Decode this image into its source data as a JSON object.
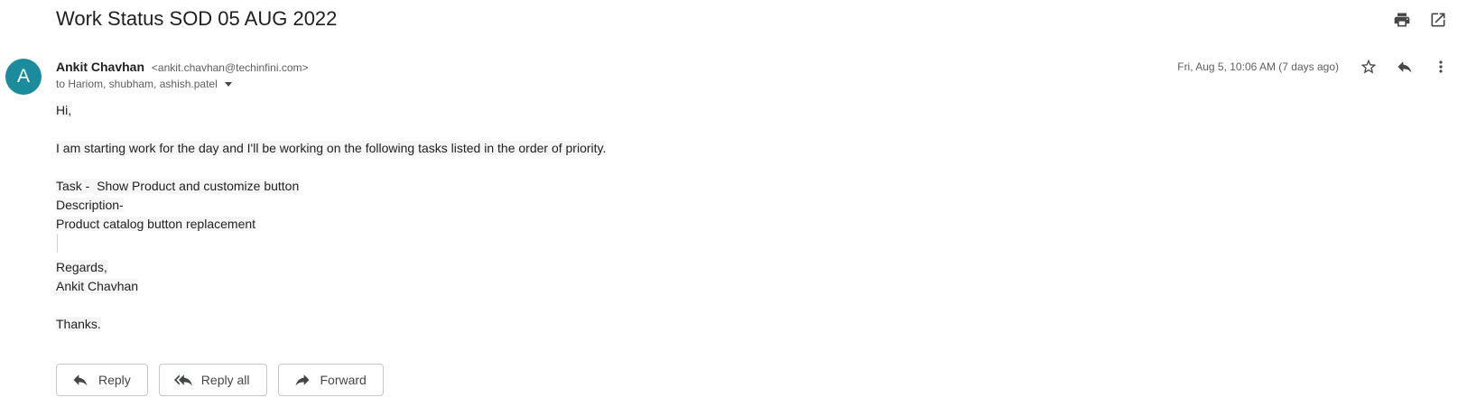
{
  "email": {
    "subject": "Work Status SOD 05 AUG 2022",
    "avatar_letter": "A",
    "avatar_color": "#1a8c9c",
    "sender_name": "Ankit Chavhan",
    "sender_email": "<ankit.chavhan@techinfini.com>",
    "recipients": "to Hariom, shubham, ashish.patel",
    "date": "Fri, Aug 5, 10:06 AM (7 days ago)",
    "body": {
      "greeting": "Hi,",
      "intro": "I am starting work for the day and I'll be working on the following tasks listed in the order of priority.",
      "task": "Task -  Show Product and customize button",
      "description_label": "Description-",
      "description": "Product catalog button replacement",
      "regards": "Regards,",
      "signature": "Ankit Chavhan",
      "thanks": "Thanks."
    }
  },
  "toolbar": {
    "print_icon": "print-icon",
    "open_new_window_icon": "open-in-new-icon",
    "star_icon": "star-icon",
    "reply_icon": "reply-icon",
    "more_icon": "more-vert-icon"
  },
  "actions": {
    "reply_label": "Reply",
    "reply_all_label": "Reply all",
    "forward_label": "Forward"
  }
}
